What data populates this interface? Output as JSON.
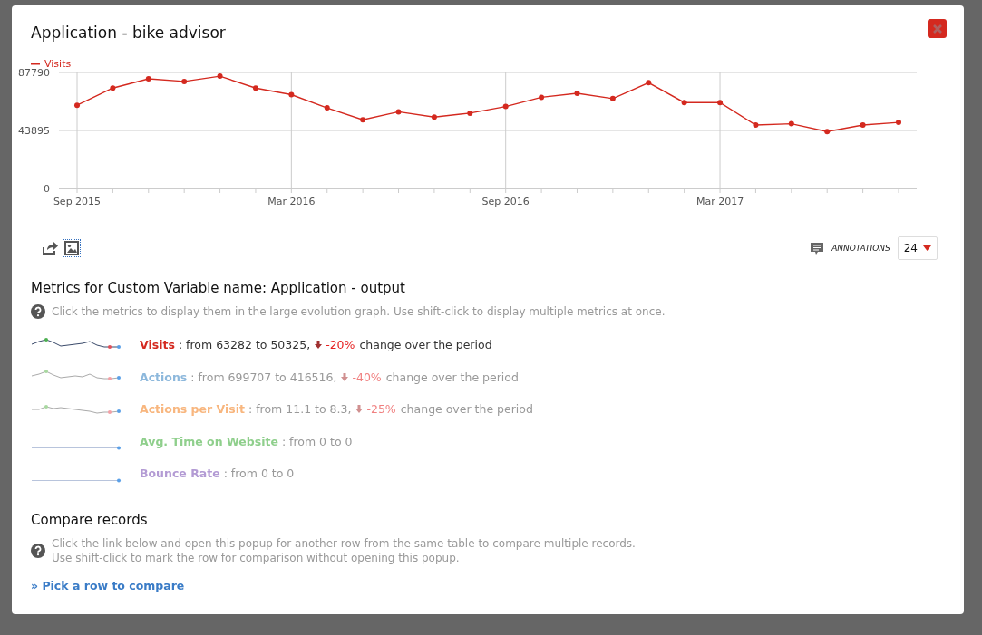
{
  "dialog": {
    "title": "Application - bike advisor"
  },
  "chart_data": {
    "type": "line",
    "categories": [
      "Sep 2015",
      null,
      null,
      null,
      null,
      null,
      "Mar 2016",
      null,
      null,
      null,
      null,
      null,
      "Sep 2016",
      null,
      null,
      null,
      null,
      null,
      "Mar 2017",
      null,
      null,
      null,
      null,
      null
    ],
    "grid": true,
    "series": [
      {
        "name": "Visits",
        "color": "#d4291f",
        "marker": true,
        "values": [
          63000,
          76000,
          83000,
          81000,
          85000,
          76000,
          71000,
          61000,
          52000,
          58000,
          54000,
          57000,
          62000,
          69000,
          72000,
          68000,
          80000,
          65000,
          65000,
          48000,
          49000,
          43000,
          48000,
          50000
        ]
      }
    ],
    "ylim": [
      0,
      87790
    ],
    "yticks": [
      0,
      43895,
      87790
    ]
  },
  "annotations": {
    "label": "ANNOTATIONS",
    "count": "24"
  },
  "metrics_section": {
    "heading": "Metrics for Custom Variable name: Application - output",
    "help": "Click the metrics to display them in the large evolution graph. Use shift-click to display multiple metrics at once.",
    "metrics": [
      {
        "name": "Visits",
        "color": "#d4291f",
        "selected": true,
        "kind": "trend",
        "detail": ": from 63282 to 50325,",
        "change": "-20%",
        "suffix": "change over the period"
      },
      {
        "name": "Actions",
        "color": "#8db8dc",
        "selected": false,
        "kind": "trend",
        "detail": ": from 699707 to 416516,",
        "change": "-40%",
        "suffix": "change over the period"
      },
      {
        "name": "Actions per Visit",
        "color": "#f8b67e",
        "selected": false,
        "kind": "trend",
        "detail": ": from 11.1 to 8.3,",
        "change": "-25%",
        "suffix": "change over the period"
      },
      {
        "name": "Avg. Time on Website",
        "color": "#8fcf8c",
        "selected": false,
        "kind": "flat",
        "detail": ": from 0 to 0"
      },
      {
        "name": "Bounce Rate",
        "color": "#b39bd4",
        "selected": false,
        "kind": "flat",
        "detail": ": from 0 to 0"
      }
    ]
  },
  "compare_section": {
    "heading": "Compare records",
    "help": [
      "Click the link below and open this popup for another row from the same table to compare multiple records.",
      "Use shift-click to mark the row for comparison without opening this popup."
    ],
    "link": "» Pick a row to compare"
  }
}
